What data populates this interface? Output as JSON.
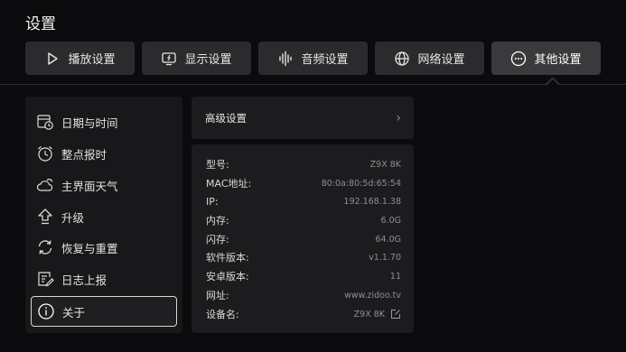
{
  "page": {
    "title": "设置"
  },
  "tabs": [
    {
      "label": "播放设置",
      "icon": "play-icon"
    },
    {
      "label": "显示设置",
      "icon": "display-icon"
    },
    {
      "label": "音频设置",
      "icon": "audio-wave-icon"
    },
    {
      "label": "网络设置",
      "icon": "globe-icon"
    },
    {
      "label": "其他设置",
      "icon": "more-icon",
      "active": true
    }
  ],
  "sidebar": {
    "items": [
      {
        "label": "日期与时间",
        "icon": "calendar-clock-icon"
      },
      {
        "label": "整点报时",
        "icon": "alarm-clock-icon"
      },
      {
        "label": "主界面天气",
        "icon": "weather-icon"
      },
      {
        "label": "升级",
        "icon": "upgrade-arrow-icon"
      },
      {
        "label": "恢复与重置",
        "icon": "reset-icon"
      },
      {
        "label": "日志上报",
        "icon": "log-report-icon"
      },
      {
        "label": "关于",
        "icon": "info-icon",
        "active": true
      }
    ]
  },
  "advanced": {
    "label": "高级设置",
    "chevron": "›"
  },
  "info": {
    "rows": [
      {
        "key": "型号:",
        "value": "Z9X 8K"
      },
      {
        "key": "MAC地址:",
        "value": "80:0a:80:5d:65:54"
      },
      {
        "key": "IP:",
        "value": "192.168.1.38"
      },
      {
        "key": "内存:",
        "value": "6.0G"
      },
      {
        "key": "闪存:",
        "value": "64.0G"
      },
      {
        "key": "软件版本:",
        "value": "v1.1.70"
      },
      {
        "key": "安卓版本:",
        "value": "11"
      },
      {
        "key": "网址:",
        "value": "www.zidoo.tv"
      },
      {
        "key": "设备名:",
        "value": "Z9X 8K",
        "icon": "edit-icon"
      }
    ]
  }
}
